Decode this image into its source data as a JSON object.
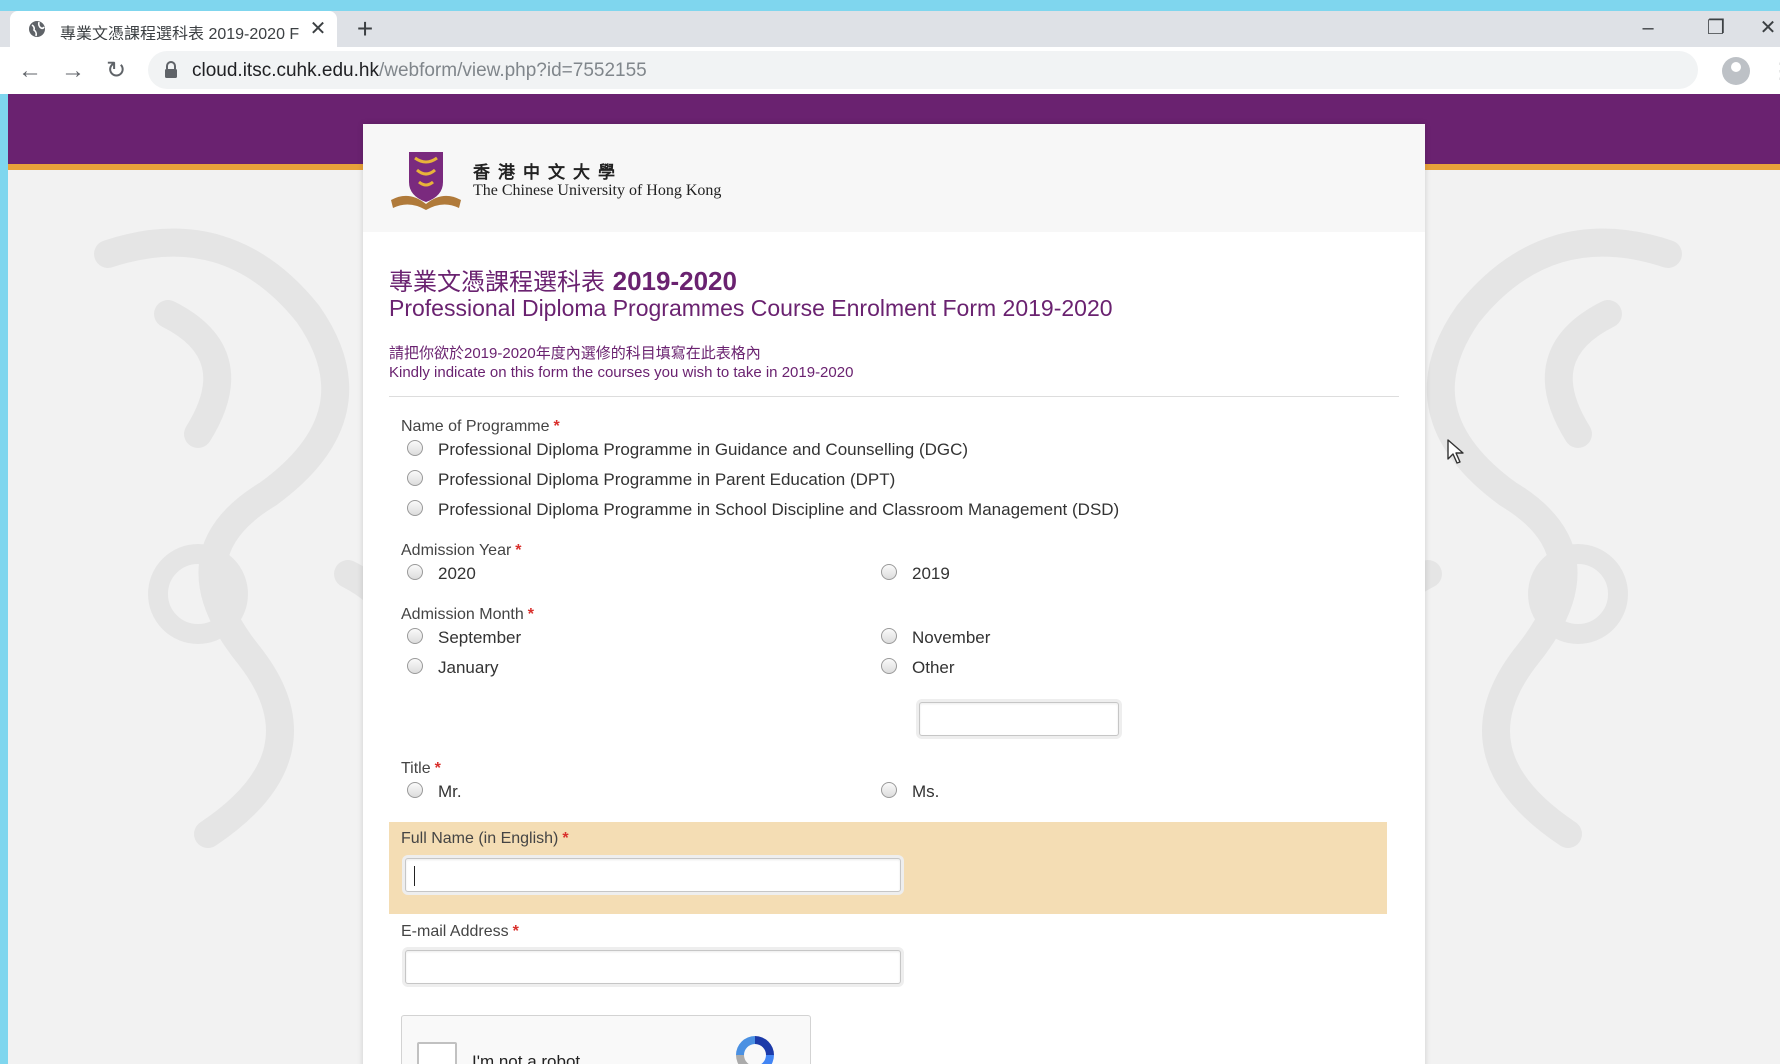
{
  "browser": {
    "tab_title": "專業文憑課程選科表 2019-2020 F",
    "new_tab_label": "+",
    "url_domain": "cloud.itsc.cuhk.edu.hk",
    "url_path": "/webform/view.php?id=7552155"
  },
  "header": {
    "university_name_zh": "香港中文大學",
    "university_name_en": "The Chinese University of Hong Kong"
  },
  "form": {
    "title_zh": "專業文憑課程選科表",
    "title_year": "2019-2020",
    "title_en": "Professional Diploma Programmes Course Enrolment Form 2019-2020",
    "note_zh": "請把你欲於2019-2020年度內選修的科目填寫在此表格內",
    "note_en": "Kindly indicate on this form the courses you wish to take in 2019-2020",
    "required_mark": "*",
    "programme": {
      "label": "Name of Programme",
      "options": [
        "Professional Diploma Programme in Guidance and Counselling (DGC)",
        "Professional Diploma Programme in Parent Education (DPT)",
        "Professional Diploma Programme in School Discipline and Classroom Management (DSD)"
      ]
    },
    "admission_year": {
      "label": "Admission Year",
      "options": [
        "2020",
        "2019"
      ]
    },
    "admission_month": {
      "label": "Admission Month",
      "options": [
        "September",
        "November",
        "January",
        "Other"
      ],
      "other_value": ""
    },
    "title_field": {
      "label": "Title",
      "options": [
        "Mr.",
        "Ms."
      ]
    },
    "full_name": {
      "label": "Full Name (in English)",
      "value": ""
    },
    "email": {
      "label": "E-mail Address",
      "value": ""
    },
    "recaptcha": {
      "label": "I'm not a robot"
    }
  },
  "colors": {
    "brand_purple": "#6a2270",
    "gold_accent": "#e8a23a",
    "highlight": "#f4ddb4",
    "required_red": "#d9302c"
  },
  "icons": [
    "globe-icon",
    "close-icon",
    "back-arrow-icon",
    "forward-arrow-icon",
    "reload-icon",
    "lock-icon",
    "star-icon",
    "profile-icon",
    "menu-icon",
    "cuhk-crest-icon",
    "recaptcha-logo-icon",
    "mouse-cursor-icon"
  ]
}
